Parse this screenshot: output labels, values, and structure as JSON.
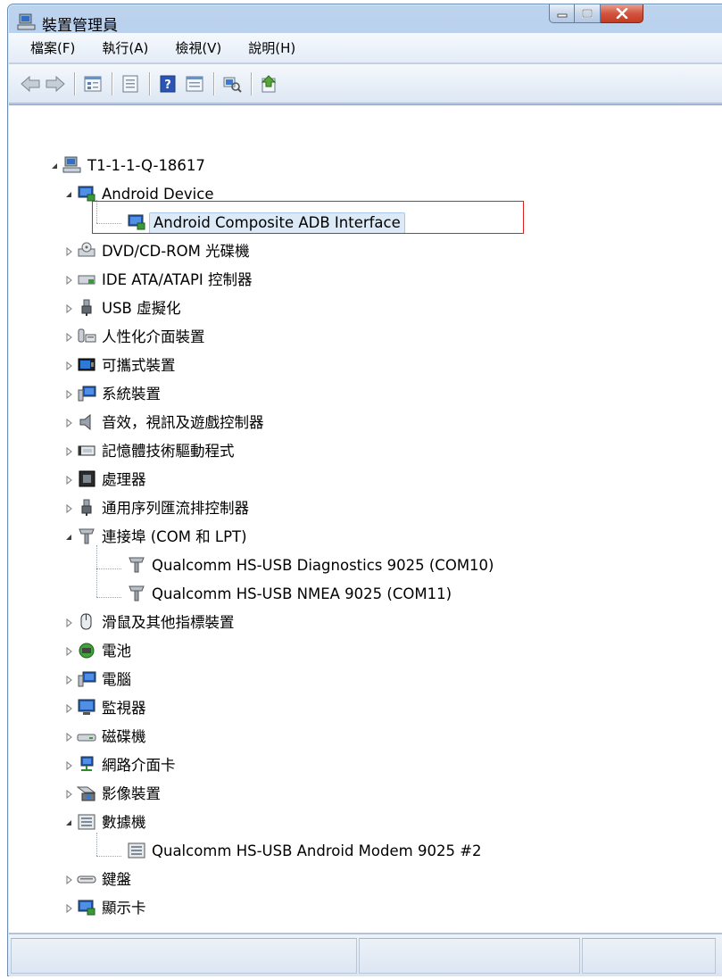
{
  "window": {
    "title": "裝置管理員"
  },
  "menu": [
    {
      "label": "檔案(F)",
      "icon": ""
    },
    {
      "label": "執行(A)"
    },
    {
      "label": "檢視(V)"
    },
    {
      "label": "說明(H)"
    }
  ],
  "toolbar_icons": [
    "back-arrow-icon",
    "forward-arrow-icon",
    "properties-icon",
    "device-list-icon",
    "help-icon",
    "view-icon",
    "scan-hardware-icon",
    "update-driver-icon"
  ],
  "tree": {
    "root": "T1-1-1-Q-18617",
    "nodes": [
      {
        "label": "Android Device",
        "expanded": true
      },
      {
        "label": "Android Composite ADB Interface",
        "selected": true
      },
      {
        "label": "DVD/CD-ROM 光碟機"
      },
      {
        "label": "IDE ATA/ATAPI 控制器"
      },
      {
        "label": "USB 虛擬化"
      },
      {
        "label": "人性化介面裝置"
      },
      {
        "label": "可攜式裝置"
      },
      {
        "label": "系統裝置"
      },
      {
        "label": "音效，視訊及遊戲控制器"
      },
      {
        "label": "記憶體技術驅動程式"
      },
      {
        "label": "處理器"
      },
      {
        "label": "通用序列匯流排控制器"
      },
      {
        "label": "連接埠 (COM 和 LPT)",
        "expanded": true
      },
      {
        "label": "Qualcomm HS-USB Diagnostics 9025 (COM10)"
      },
      {
        "label": "Qualcomm HS-USB NMEA 9025 (COM11)"
      },
      {
        "label": "滑鼠及其他指標裝置"
      },
      {
        "label": "電池"
      },
      {
        "label": "電腦"
      },
      {
        "label": "監視器"
      },
      {
        "label": "磁碟機"
      },
      {
        "label": "網路介面卡"
      },
      {
        "label": "影像裝置"
      },
      {
        "label": "數據機",
        "expanded": true
      },
      {
        "label": "Qualcomm HS-USB Android Modem 9025 #2"
      },
      {
        "label": "鍵盤"
      },
      {
        "label": "顯示卡"
      }
    ]
  },
  "colors": {
    "titlebar": "#b7cfec",
    "highlight": "#e0201e",
    "selection": "#dceaf7"
  }
}
